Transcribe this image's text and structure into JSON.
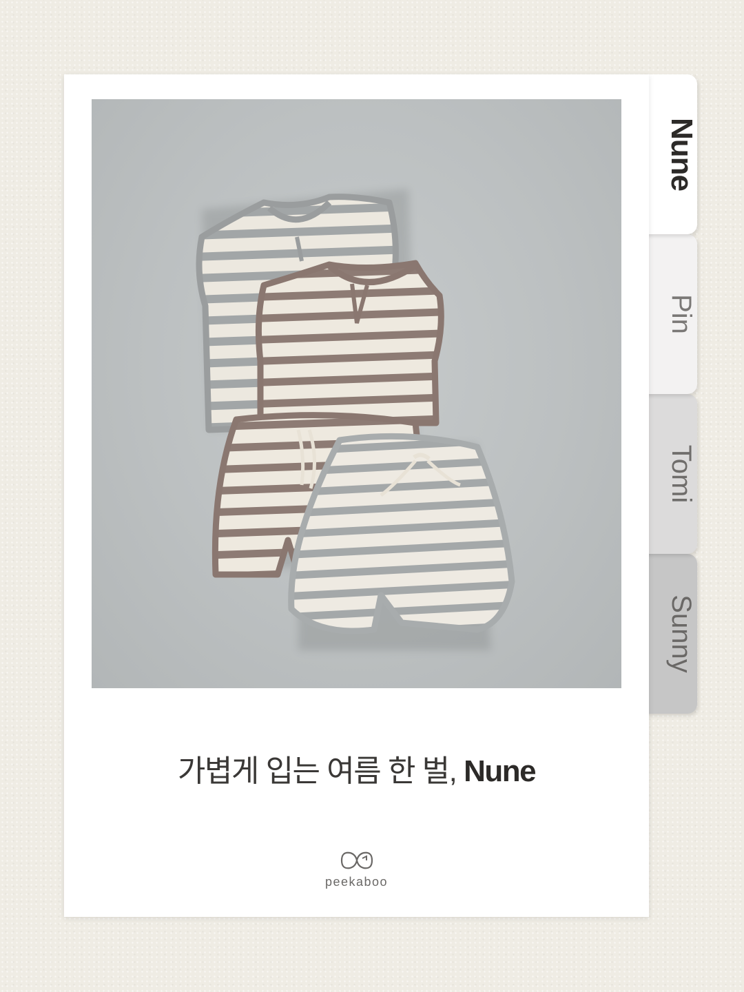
{
  "tabs": [
    {
      "label": "Nune",
      "active": true
    },
    {
      "label": "Pin",
      "active": false
    },
    {
      "label": "Tomi",
      "active": false
    },
    {
      "label": "Sunny",
      "active": false
    }
  ],
  "caption": {
    "text": "가볍게 입는 여름 한 벌, ",
    "name": "Nune"
  },
  "brand": {
    "name": "peekaboo"
  },
  "colors": {
    "background": "#efece4",
    "card": "#ffffff",
    "photo_background": "#bfc3c4",
    "stripe_gray": "#9ea2a3",
    "stripe_brown": "#8d7b74",
    "fabric_cream": "#eee9df",
    "text_dark": "#2c2a28"
  }
}
